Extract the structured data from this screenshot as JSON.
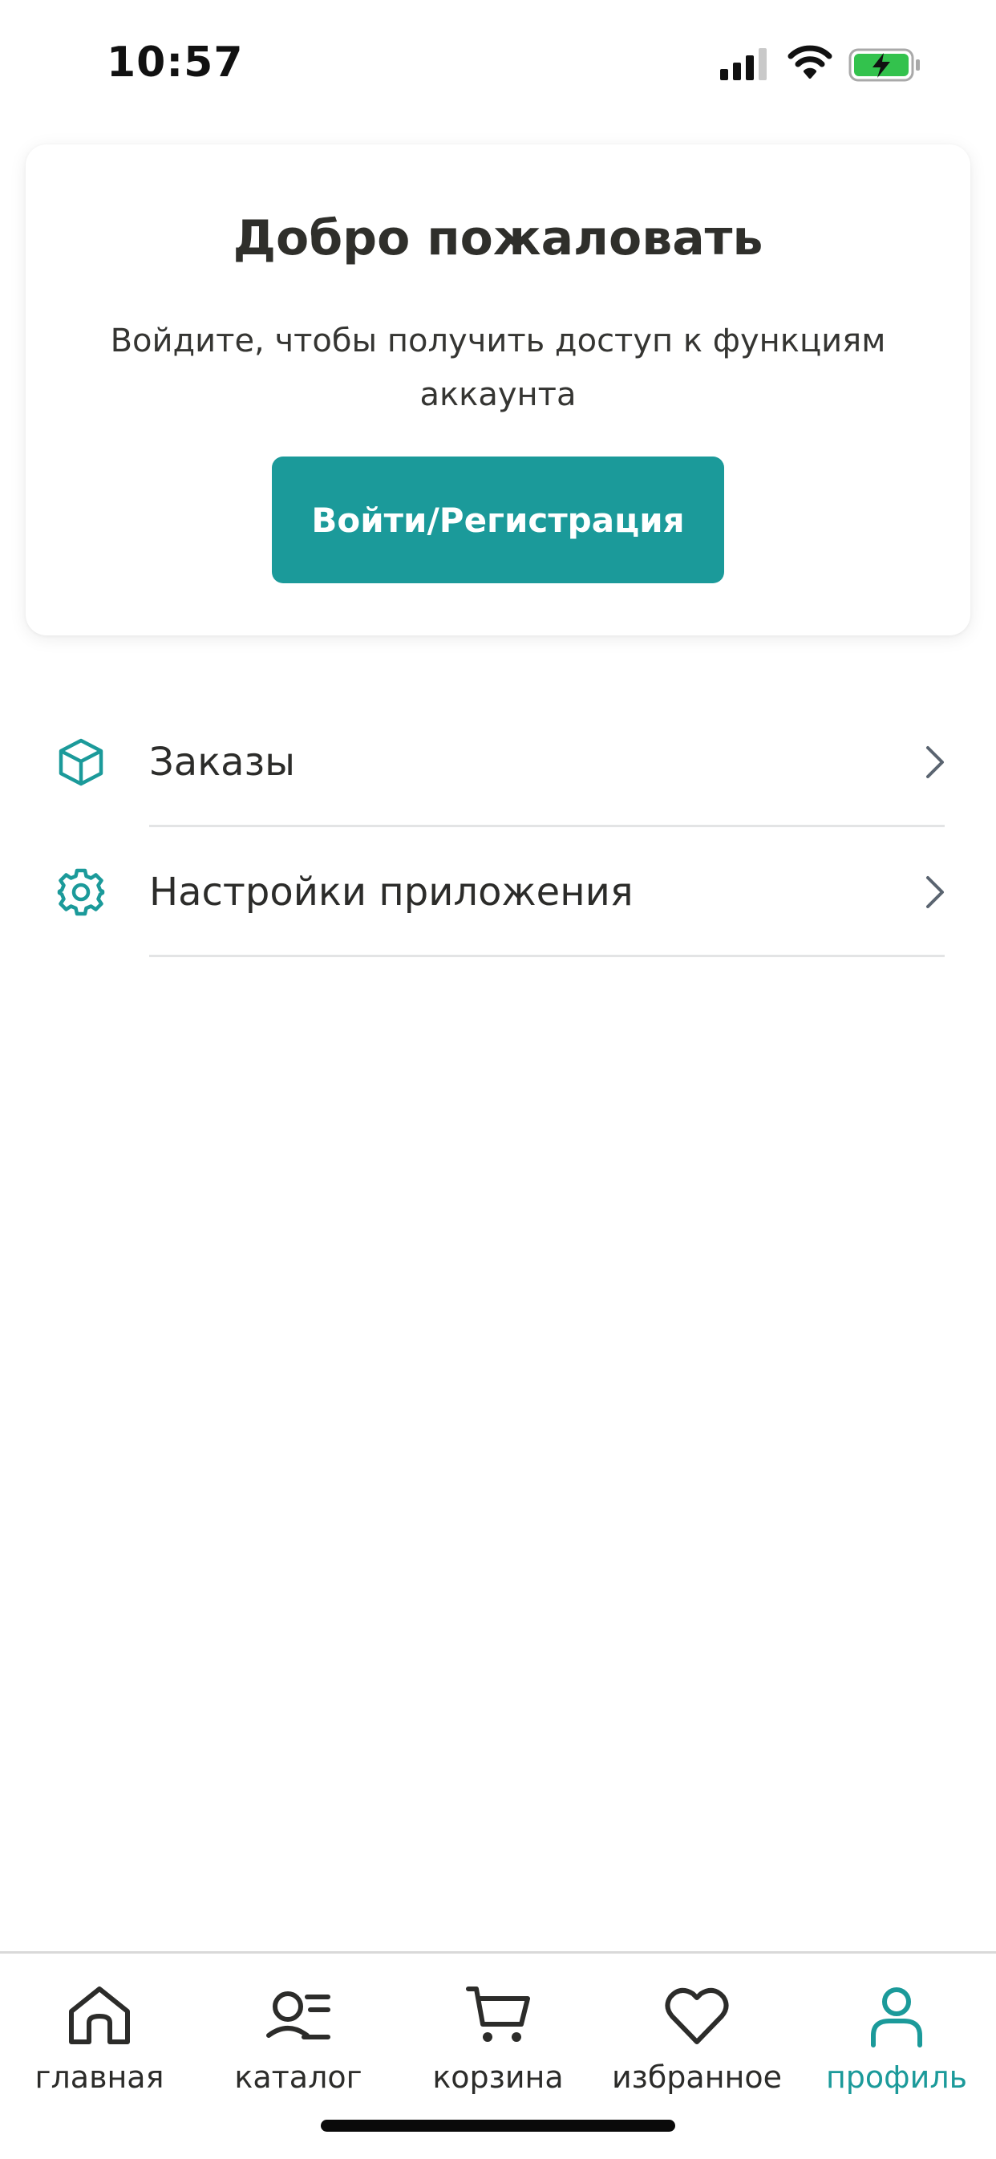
{
  "status_bar": {
    "time": "10:57"
  },
  "welcome": {
    "title": "Добро пожаловать",
    "subtitle": "Войдите, чтобы получить доступ к функциям аккаунта",
    "button_label": "Войти/Регистрация"
  },
  "menu": {
    "items": [
      {
        "label": "Заказы",
        "icon": "package-icon"
      },
      {
        "label": "Настройки приложения",
        "icon": "gear-icon"
      }
    ]
  },
  "tab_bar": {
    "tabs": [
      {
        "label": "главная",
        "icon": "home-icon",
        "active": false
      },
      {
        "label": "каталог",
        "icon": "catalog-icon",
        "active": false
      },
      {
        "label": "корзина",
        "icon": "cart-icon",
        "active": false
      },
      {
        "label": "избранное",
        "icon": "heart-icon",
        "active": false
      },
      {
        "label": "профиль",
        "icon": "user-icon",
        "active": true
      }
    ]
  },
  "colors": {
    "accent": "#1b9a9a",
    "text": "#2c2c2a",
    "divider": "#e3e4e5"
  }
}
